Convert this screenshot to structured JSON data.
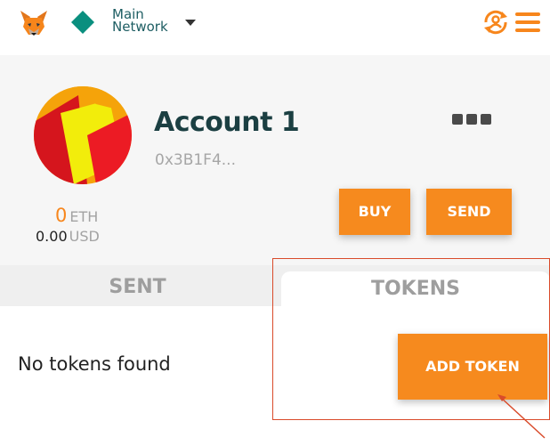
{
  "header": {
    "network_line1": "Main",
    "network_line2": "Network"
  },
  "account": {
    "name": "Account 1",
    "address": "0x3B1F4..."
  },
  "balance": {
    "eth_amount": "0",
    "eth_unit": "ETH",
    "usd_amount": "0.00",
    "usd_unit": "USD"
  },
  "actions": {
    "buy_label": "BUY",
    "send_label": "SEND"
  },
  "tabs": [
    {
      "label": "SENT",
      "active": false
    },
    {
      "label": "TOKENS",
      "active": true
    }
  ],
  "tokens": {
    "empty_message": "No tokens found",
    "add_label": "ADD TOKEN"
  },
  "icons": {
    "brand": "metamask-fox-icon",
    "network": "network-diamond-icon",
    "sync": "account-sync-icon",
    "menu": "hamburger-menu-icon",
    "more": "more-dots-icon"
  },
  "colors": {
    "accent": "#f68a1e",
    "network": "#0a8f7f",
    "title": "#1b3f42",
    "annotation": "#d94b2b"
  }
}
